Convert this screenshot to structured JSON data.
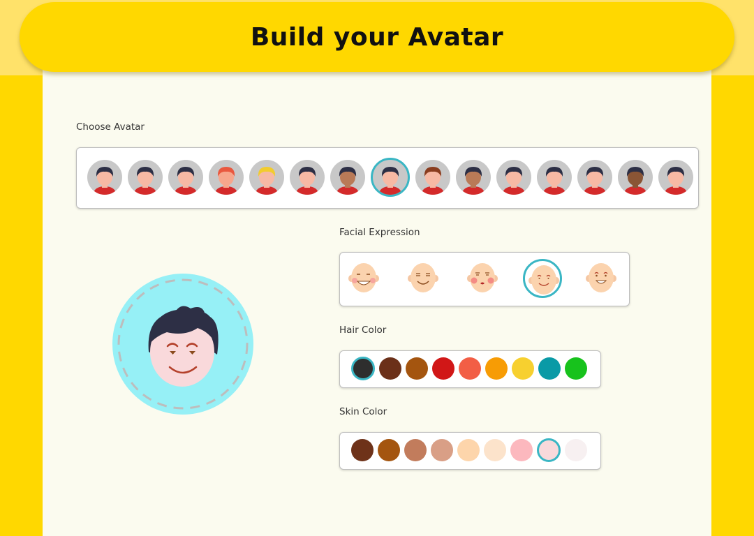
{
  "header": {
    "title": "Build your Avatar"
  },
  "labels": {
    "choose_avatar": "Choose Avatar",
    "facial_expression": "Facial Expression",
    "hair_color": "Hair Color",
    "skin_color": "Skin Color"
  },
  "avatars": {
    "selected_index": 7,
    "items": [
      {
        "hair": "#2d2f45",
        "skin": "#f7b9a4"
      },
      {
        "hair": "#2d2f45",
        "skin": "#f7b9a4"
      },
      {
        "hair": "#2d2f45",
        "skin": "#f7b9a4"
      },
      {
        "hair": "#e9583f",
        "skin": "#f7a68c"
      },
      {
        "hair": "#f2cc2e",
        "skin": "#f7b9a4"
      },
      {
        "hair": "#2d2f45",
        "skin": "#f7b9a4"
      },
      {
        "hair": "#2d2f45",
        "skin": "#b97a57"
      },
      {
        "hair": "#2d2f45",
        "skin": "#f7b9a4"
      },
      {
        "hair": "#8a3d1f",
        "skin": "#f7b9a4"
      },
      {
        "hair": "#2d2f45",
        "skin": "#b97a57"
      },
      {
        "hair": "#2d2f45",
        "skin": "#f7b9a4"
      },
      {
        "hair": "#2d2f45",
        "skin": "#f7b9a4"
      },
      {
        "hair": "#2d2f45",
        "skin": "#f7b9a4"
      },
      {
        "hair": "#2d2f45",
        "skin": "#8a5535"
      },
      {
        "hair": "#2d2f45",
        "skin": "#f7b9a4"
      }
    ]
  },
  "expressions": {
    "selected_index": 3,
    "items": [
      "laughing",
      "happy-closed-eyes",
      "blushing-kiss",
      "smiling",
      "grinning"
    ]
  },
  "hair_colors": {
    "selected_index": 0,
    "items": [
      "#2e2e2e",
      "#6b3019",
      "#a4550f",
      "#d11717",
      "#f25e45",
      "#f79c05",
      "#f7d02f",
      "#0a9aa6",
      "#17c21c"
    ]
  },
  "skin_colors": {
    "selected_index": 7,
    "items": [
      "#6e3219",
      "#a4550f",
      "#c27c5c",
      "#d99f86",
      "#fdd5ab",
      "#fce3cb",
      "#fcb8be",
      "#f9d9db",
      "#f7f0f1"
    ]
  },
  "preview": {
    "background": "#96f0f6",
    "hair": "#2d2f45",
    "skin": "#f9d9db",
    "expression": "smiling"
  },
  "colors": {
    "accent": "#3ab6c4",
    "brand": "#ffd800"
  }
}
